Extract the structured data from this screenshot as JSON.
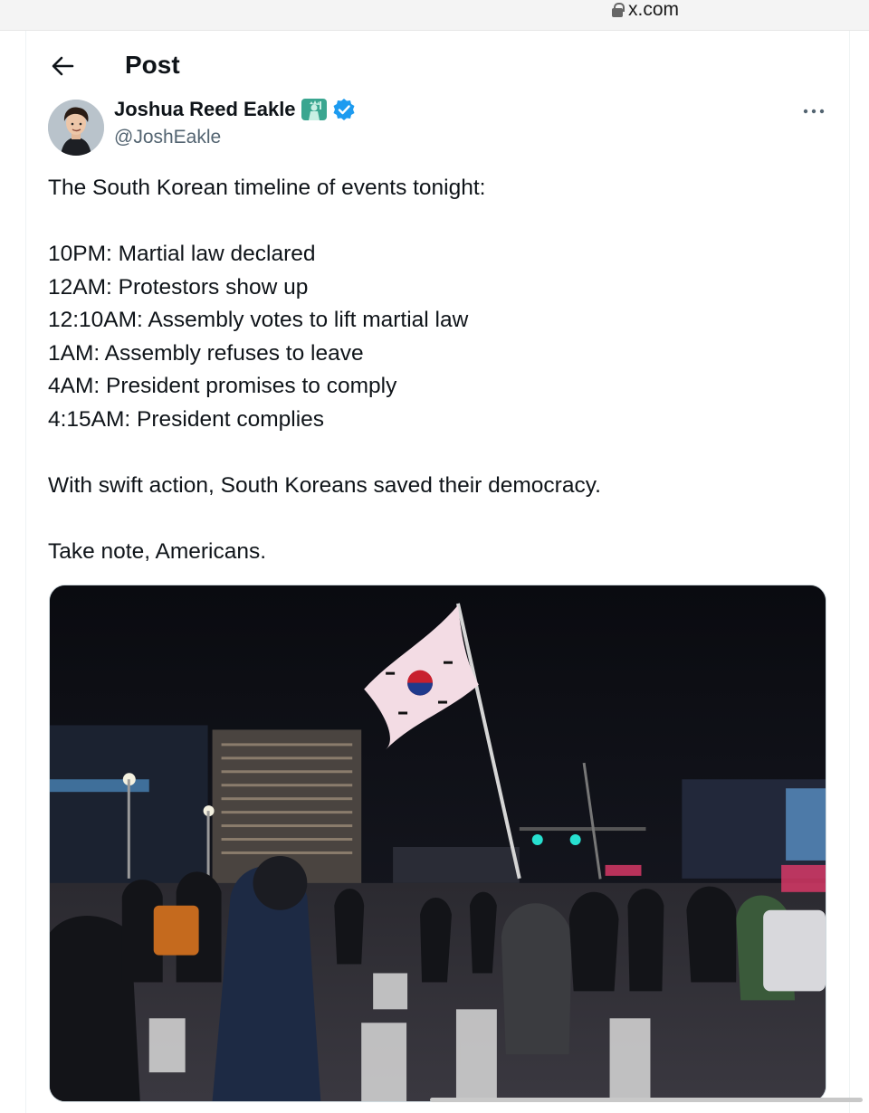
{
  "browser": {
    "url": "x.com"
  },
  "header": {
    "title": "Post"
  },
  "author": {
    "name": "Joshua Reed Eakle",
    "handle": "@JoshEakle",
    "emoji": "statue-of-liberty-emoji",
    "verified": true
  },
  "post": {
    "lines": [
      "The South Korean timeline of events tonight:",
      "",
      "10PM: Martial law declared",
      "12AM: Protestors show up",
      "12:10AM: Assembly votes to lift martial law",
      "1AM: Assembly refuses to leave",
      "4AM: President promises to comply",
      "4:15AM: President complies",
      "",
      "With swift action, South Koreans saved their democracy.",
      "",
      "Take note, Americans."
    ]
  },
  "colors": {
    "text": "#0f1419",
    "secondary": "#536471",
    "verified": "#1d9bf0",
    "emoji": "#3aa690"
  }
}
